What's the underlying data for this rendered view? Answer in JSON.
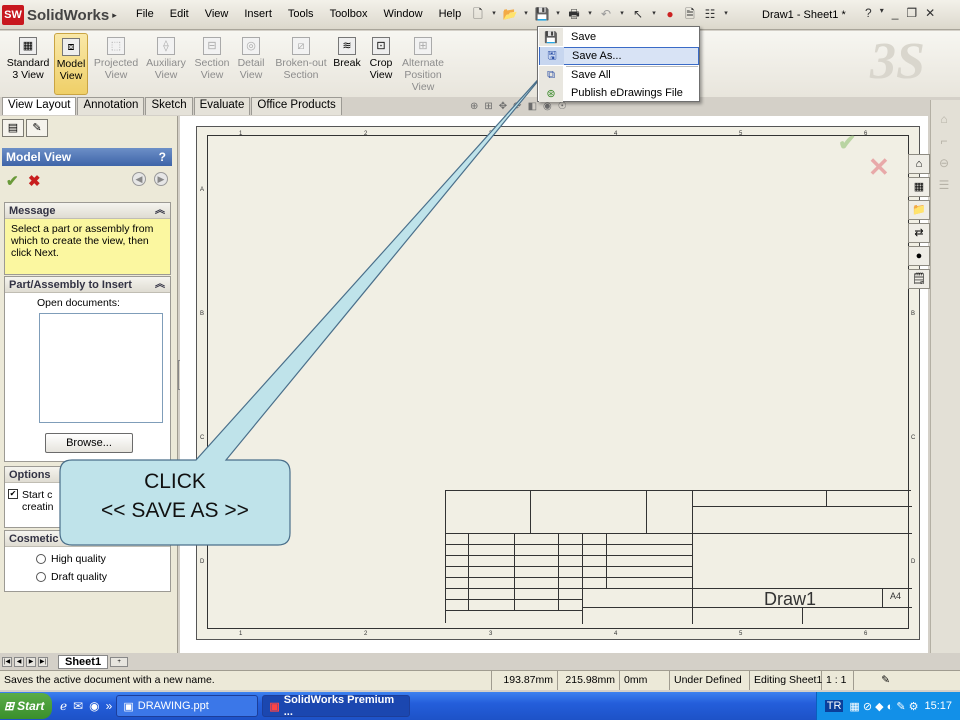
{
  "app": {
    "brand": "SolidWorks",
    "logo_badge": "SW",
    "doc_title": "Draw1 - Sheet1 *"
  },
  "menu": [
    "File",
    "Edit",
    "View",
    "Insert",
    "Tools",
    "Toolbox",
    "Window",
    "Help"
  ],
  "command_manager": [
    {
      "line1": "Standard",
      "line2": "3 View",
      "line3": "",
      "state": "normal",
      "icon": "standard-3-view-icon"
    },
    {
      "line1": "Model",
      "line2": "View",
      "line3": "",
      "state": "selected",
      "icon": "model-view-icon"
    },
    {
      "line1": "Projected",
      "line2": "View",
      "line3": "",
      "state": "disabled",
      "icon": "projected-view-icon"
    },
    {
      "line1": "Auxiliary",
      "line2": "View",
      "line3": "",
      "state": "disabled",
      "icon": "auxiliary-view-icon"
    },
    {
      "line1": "Section",
      "line2": "View",
      "line3": "",
      "state": "disabled",
      "icon": "section-view-icon"
    },
    {
      "line1": "Detail",
      "line2": "View",
      "line3": "",
      "state": "disabled",
      "icon": "detail-view-icon"
    },
    {
      "line1": "Broken-out",
      "line2": "Section",
      "line3": "",
      "state": "disabled",
      "icon": "broken-out-section-icon"
    },
    {
      "line1": "Break",
      "line2": "",
      "line3": "",
      "state": "normal",
      "icon": "break-icon"
    },
    {
      "line1": "Crop",
      "line2": "View",
      "line3": "",
      "state": "normal",
      "icon": "crop-view-icon"
    },
    {
      "line1": "Alternate",
      "line2": "Position",
      "line3": "View",
      "state": "disabled",
      "icon": "alternate-position-view-icon"
    }
  ],
  "tabs": [
    {
      "label": "View Layout",
      "active": true
    },
    {
      "label": "Annotation",
      "active": false
    },
    {
      "label": "Sketch",
      "active": false
    },
    {
      "label": "Evaluate",
      "active": false
    },
    {
      "label": "Office Products",
      "active": false
    }
  ],
  "save_menu": [
    {
      "label": "Save",
      "icon": "save-icon",
      "highlighted": false
    },
    {
      "label": "Save As...",
      "icon": "save-as-icon",
      "highlighted": true
    },
    {
      "label": "Save All",
      "icon": "save-all-icon",
      "highlighted": false
    },
    {
      "label": "Publish eDrawings File",
      "icon": "publish-edrawings-icon",
      "highlighted": false
    }
  ],
  "property_manager": {
    "title": "Model View",
    "help": "?",
    "message_header": "Message",
    "message_text": "Select a part or assembly from which to create the view, then click Next.",
    "part_header": "Part/Assembly to Insert",
    "open_docs_label": "Open documents:",
    "browse_label": "Browse...",
    "options_header": "Options",
    "start_cmd_text_1": "Start c",
    "start_cmd_text_2": "creatin",
    "cosmetic_header": "Cosmetic",
    "high_quality": "High quality",
    "draft_quality": "Draft quality"
  },
  "sheet_tab": "Sheet1",
  "drawing": {
    "sheet_name": "Draw1",
    "sheet_size": "A4",
    "zone_cols": [
      "1",
      "2",
      "3",
      "4",
      "5",
      "6"
    ],
    "zone_rows": [
      "A",
      "B",
      "C",
      "D"
    ]
  },
  "callout": {
    "line1": "CLICK",
    "line2": "<< SAVE AS >>"
  },
  "status_bar": {
    "message": "Saves the active document with a new name.",
    "x": "193.87mm",
    "y": "215.98mm",
    "z": "0mm",
    "state": "Under Defined",
    "editing": "Editing Sheet1",
    "scale": "1 : 1"
  },
  "taskbar": {
    "start": "Start",
    "overflow": "»",
    "items": [
      {
        "label": "DRAWING.ppt",
        "active": false
      },
      {
        "label": "SolidWorks Premium ...",
        "active": true
      }
    ],
    "lang": "TR",
    "clock": "15:17"
  },
  "colors": {
    "callout_fill": "#bfe3ea",
    "callout_stroke": "#4a6f8a",
    "highlight": "#d8e3f5",
    "message_bg": "#fbf7a0",
    "brand_red": "#c8171e"
  }
}
